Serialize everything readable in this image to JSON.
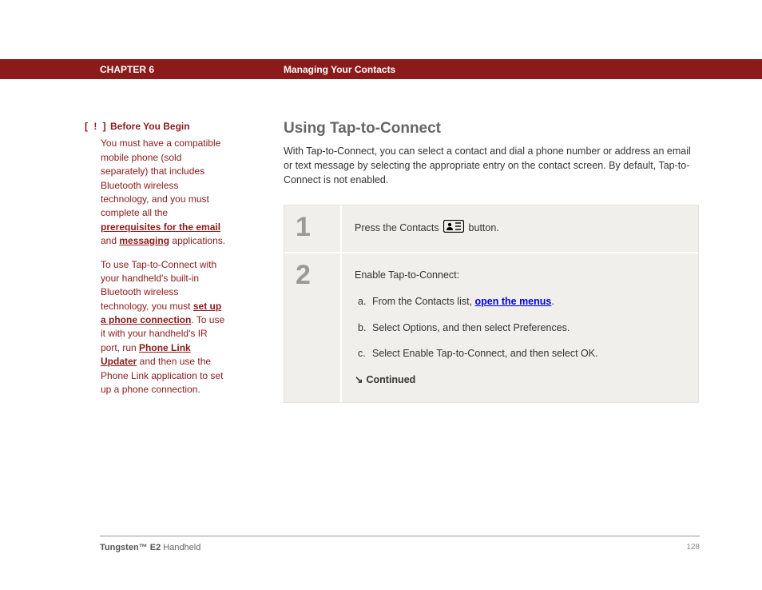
{
  "header": {
    "chapter": "CHAPTER 6",
    "title": "Managing Your Contacts"
  },
  "sidebar": {
    "exclaim": "[ ! ]",
    "heading": "Before You Begin",
    "para1_a": "You must have a compatible mobile phone (sold separately) that includes Bluetooth wireless technology, and you must complete all the ",
    "link1": "prerequisites for the email",
    "para1_b": " and ",
    "link2": "messaging",
    "para1_c": " applications.",
    "para2_a": "To use Tap-to-Connect with your handheld's built-in Bluetooth wireless technology, you must ",
    "link3": "set up a phone connection",
    "para2_b": ". To use it with your handheld's IR port, run ",
    "link4": "Phone Link Updater",
    "para2_c": " and then use the Phone Link application to set up a phone connection."
  },
  "main": {
    "title": "Using Tap-to-Connect",
    "intro": "With Tap-to-Connect, you can select a contact and dial a phone number or address an email or text message by selecting the appropriate entry on the contact screen. By default, Tap-to-Connect is not enabled.",
    "steps": [
      {
        "num": "1",
        "text_a": "Press the Contacts ",
        "text_b": " button."
      },
      {
        "num": "2",
        "lead": "Enable Tap-to-Connect:",
        "subs": {
          "a_label": "a.",
          "a_text_1": "From the Contacts list, ",
          "a_link": "open the menus",
          "a_text_2": ".",
          "b_label": "b.",
          "b_text": "Select Options, and then select Preferences.",
          "c_label": "c.",
          "c_text": "Select Enable Tap-to-Connect, and then select OK."
        },
        "continued": "Continued"
      }
    ]
  },
  "footer": {
    "bold": "Tungsten™ E2",
    "rest": " Handheld",
    "page": "128"
  }
}
